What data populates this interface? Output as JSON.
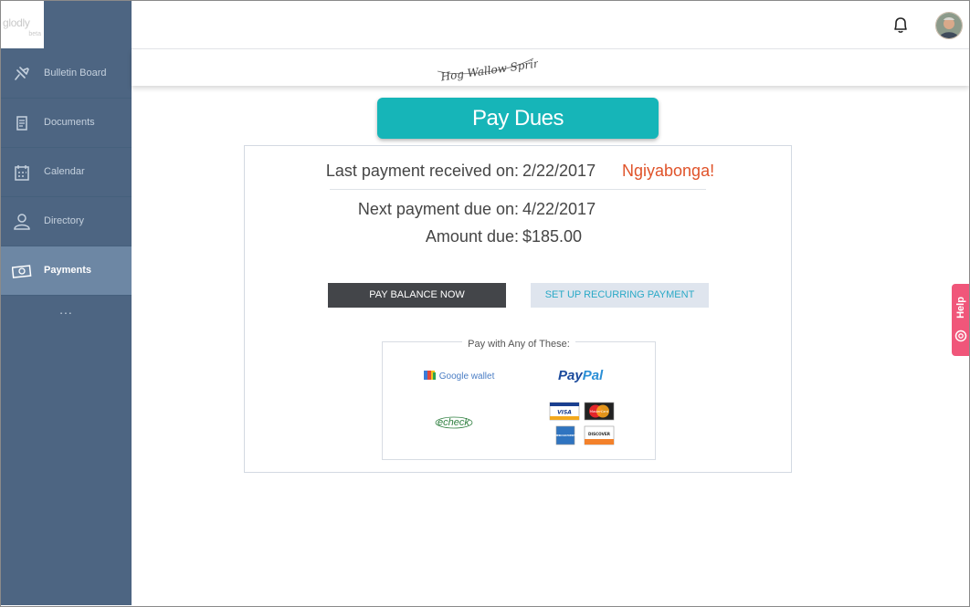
{
  "app": {
    "logo_text": "glodly",
    "logo_sub": "beta"
  },
  "sidebar": {
    "items": [
      {
        "label": "Bulletin Board",
        "icon": "pushpin-icon",
        "active": false
      },
      {
        "label": "Documents",
        "icon": "document-icon",
        "active": false
      },
      {
        "label": "Calendar",
        "icon": "calendar-icon",
        "active": false
      },
      {
        "label": "Directory",
        "icon": "person-icon",
        "active": false
      },
      {
        "label": "Payments",
        "icon": "money-icon",
        "active": true
      }
    ],
    "more_label": "..."
  },
  "header": {
    "community_logo_text": "Hog Wallow Springs",
    "notifications_icon": "bell-icon",
    "avatar_icon": "user-avatar"
  },
  "main": {
    "title": "Pay Dues",
    "last_payment_label": "Last payment received on:",
    "last_payment_date": "2/22/2017",
    "thanks_text": "Ngiyabonga!",
    "next_payment_label": "Next payment due on:",
    "next_payment_date": "4/22/2017",
    "amount_label": "Amount due:",
    "amount_value": "$185.00",
    "pay_now_label": "PAY BALANCE NOW",
    "recurring_label": "SET UP RECURRING PAYMENT",
    "methods_title": "Pay with Any of These:",
    "methods": {
      "google_wallet": "Google wallet",
      "paypal_pay": "Pay",
      "paypal_pal": "Pal",
      "echeck": "echeck",
      "card_visa": "VISA",
      "card_mastercard": "MasterCard",
      "card_amex": "AMERICAN EXPRESS",
      "card_discover": "DISCOVER"
    }
  },
  "help": {
    "label": "Help"
  },
  "colors": {
    "sidebar": "#4d6582",
    "sidebar_active": "#6d87a4",
    "accent": "#16b5b8",
    "thanks": "#e0532a",
    "help": "#f0567a"
  }
}
